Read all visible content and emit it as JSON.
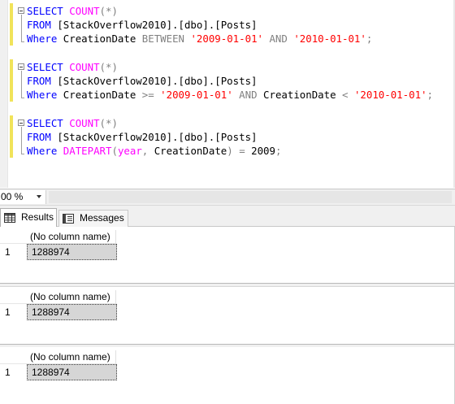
{
  "editor": {
    "queries": [
      {
        "line1": {
          "kw": "SELECT",
          "fn": "COUNT",
          "rest": "(*)"
        },
        "line2": {
          "kw": "FROM",
          "text": "[StackOverflow2010].[dbo].[Posts]"
        },
        "line3": {
          "kw": "Where",
          "col": "CreationDate",
          "op1": "BETWEEN",
          "str1": "'2009-01-01'",
          "op2": "AND",
          "str2": "'2010-01-01'",
          "end": ";"
        }
      },
      {
        "line1": {
          "kw": "SELECT",
          "fn": "COUNT",
          "rest": "(*)"
        },
        "line2": {
          "kw": "FROM",
          "text": "[StackOverflow2010].[dbo].[Posts]"
        },
        "line3": {
          "kw": "Where",
          "col": "CreationDate",
          "op1": ">=",
          "str1": "'2009-01-01'",
          "op2": "AND",
          "col2": "CreationDate",
          "op3": "<",
          "str2": "'2010-01-01'",
          "end": ";"
        }
      },
      {
        "line1": {
          "kw": "SELECT",
          "fn": "COUNT",
          "rest": "(*)"
        },
        "line2": {
          "kw": "FROM",
          "text": "[StackOverflow2010].[dbo].[Posts]"
        },
        "line3": {
          "kw": "Where",
          "fn": "DATEPART",
          "open": "(",
          "arg1": "year",
          "sep": ",",
          "col": "CreationDate",
          "close": ")",
          "op": "=",
          "num": "2009",
          "end": ";"
        }
      }
    ]
  },
  "zoom": {
    "value": "00 %"
  },
  "tabs": {
    "results_label": "Results",
    "messages_label": "Messages",
    "results_icon": "grid-icon",
    "messages_icon": "messages-icon"
  },
  "results": {
    "grids": [
      {
        "header": "(No column name)",
        "row_number": "1",
        "value": "1288974"
      },
      {
        "header": "(No column name)",
        "row_number": "1",
        "value": "1288974"
      },
      {
        "header": "(No column name)",
        "row_number": "1",
        "value": "1288974"
      }
    ]
  },
  "colors": {
    "keyword": "#0000ff",
    "function": "#ff00ff",
    "operator": "#808080",
    "string": "#ff0000",
    "change_bar": "#f1e35a",
    "selected_cell": "#d6d6d6"
  }
}
